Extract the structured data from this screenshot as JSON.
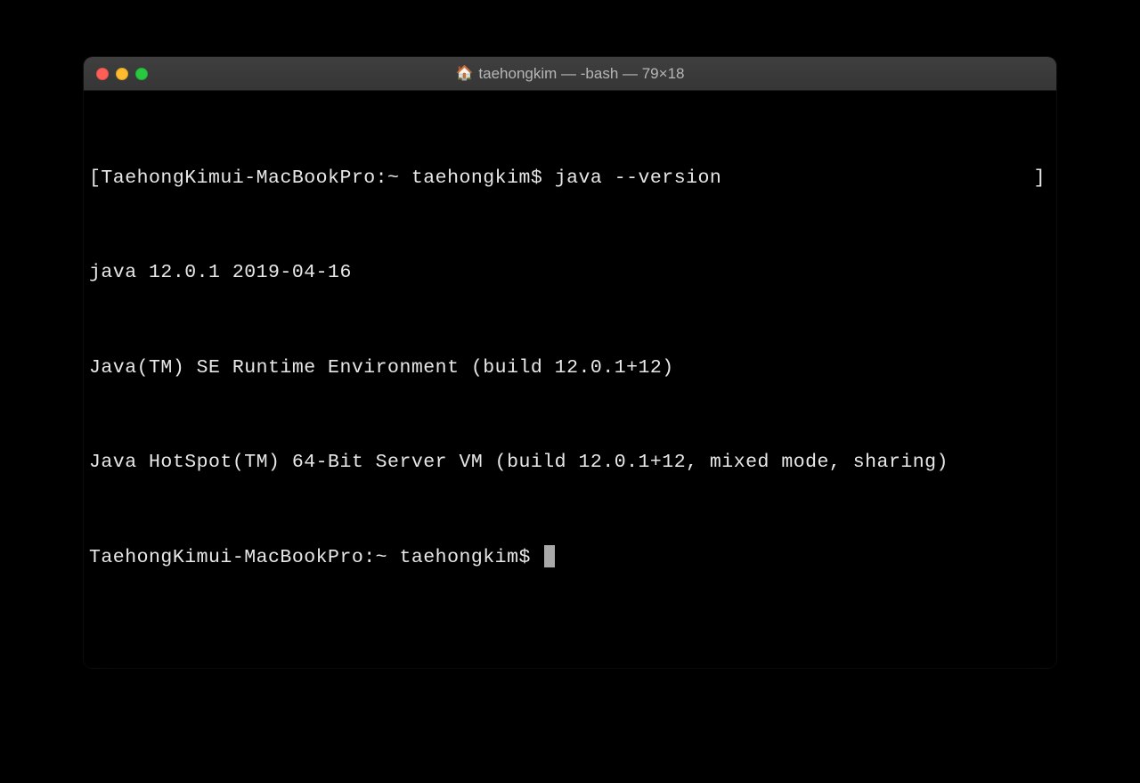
{
  "window": {
    "title": "taehongkim — -bash — 79×18"
  },
  "terminal": {
    "lines": [
      {
        "left_bracket": "[",
        "prompt": "TaehongKimui-MacBookPro:~ taehongkim$ ",
        "command": "java --version",
        "right_bracket": "]"
      },
      "java 12.0.1 2019-04-16",
      "Java(TM) SE Runtime Environment (build 12.0.1+12)",
      "Java HotSpot(TM) 64-Bit Server VM (build 12.0.1+12, mixed mode, sharing)"
    ],
    "current_prompt": "TaehongKimui-MacBookPro:~ taehongkim$ "
  }
}
